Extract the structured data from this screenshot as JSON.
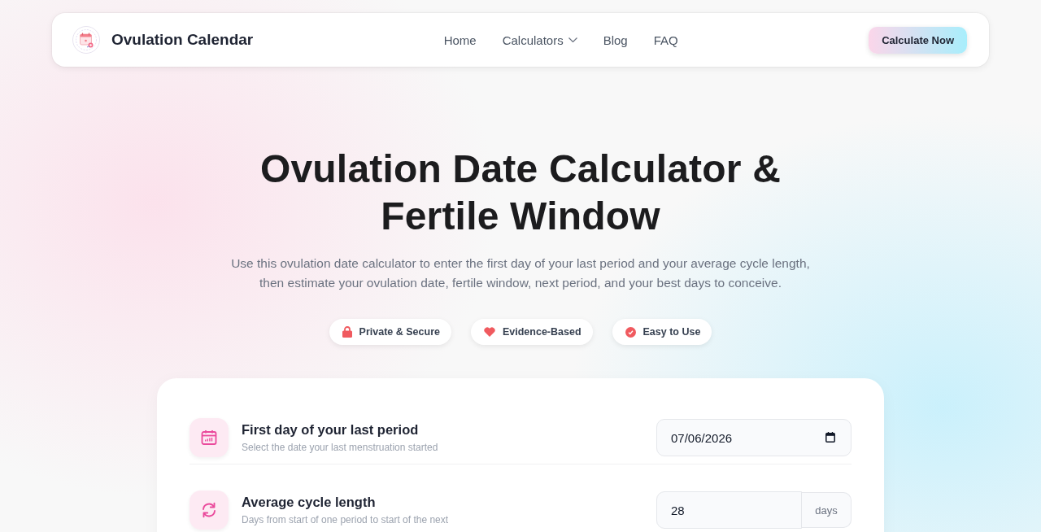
{
  "nav": {
    "brand": "Ovulation Calendar",
    "links": [
      {
        "label": "Home",
        "kind": "link"
      },
      {
        "label": "Calculators",
        "kind": "dropdown"
      },
      {
        "label": "Blog",
        "kind": "link"
      },
      {
        "label": "FAQ",
        "kind": "link"
      }
    ],
    "cta": "Calculate Now"
  },
  "hero": {
    "title": "Ovulation Date Calculator & Fertile Window",
    "subtitle": "Use this ovulation date calculator to enter the first day of your last period and your average cycle length, then estimate your ovulation date, fertile window, next period, and your best days to conceive.",
    "badges": [
      {
        "label": "Private & Secure",
        "kind": "privacy"
      },
      {
        "label": "Evidence-Based",
        "kind": "evidence"
      },
      {
        "label": "Easy to Use",
        "kind": "ease"
      }
    ]
  },
  "form": {
    "fields": [
      {
        "kind": "date",
        "label": "First day of your last period",
        "hint": "Select the date your last menstruation started",
        "value": "07/06/2026"
      },
      {
        "kind": "number",
        "label": "Average cycle length",
        "hint": "Days from start of one period to start of the next",
        "value": "28",
        "unit": "days"
      }
    ]
  }
}
